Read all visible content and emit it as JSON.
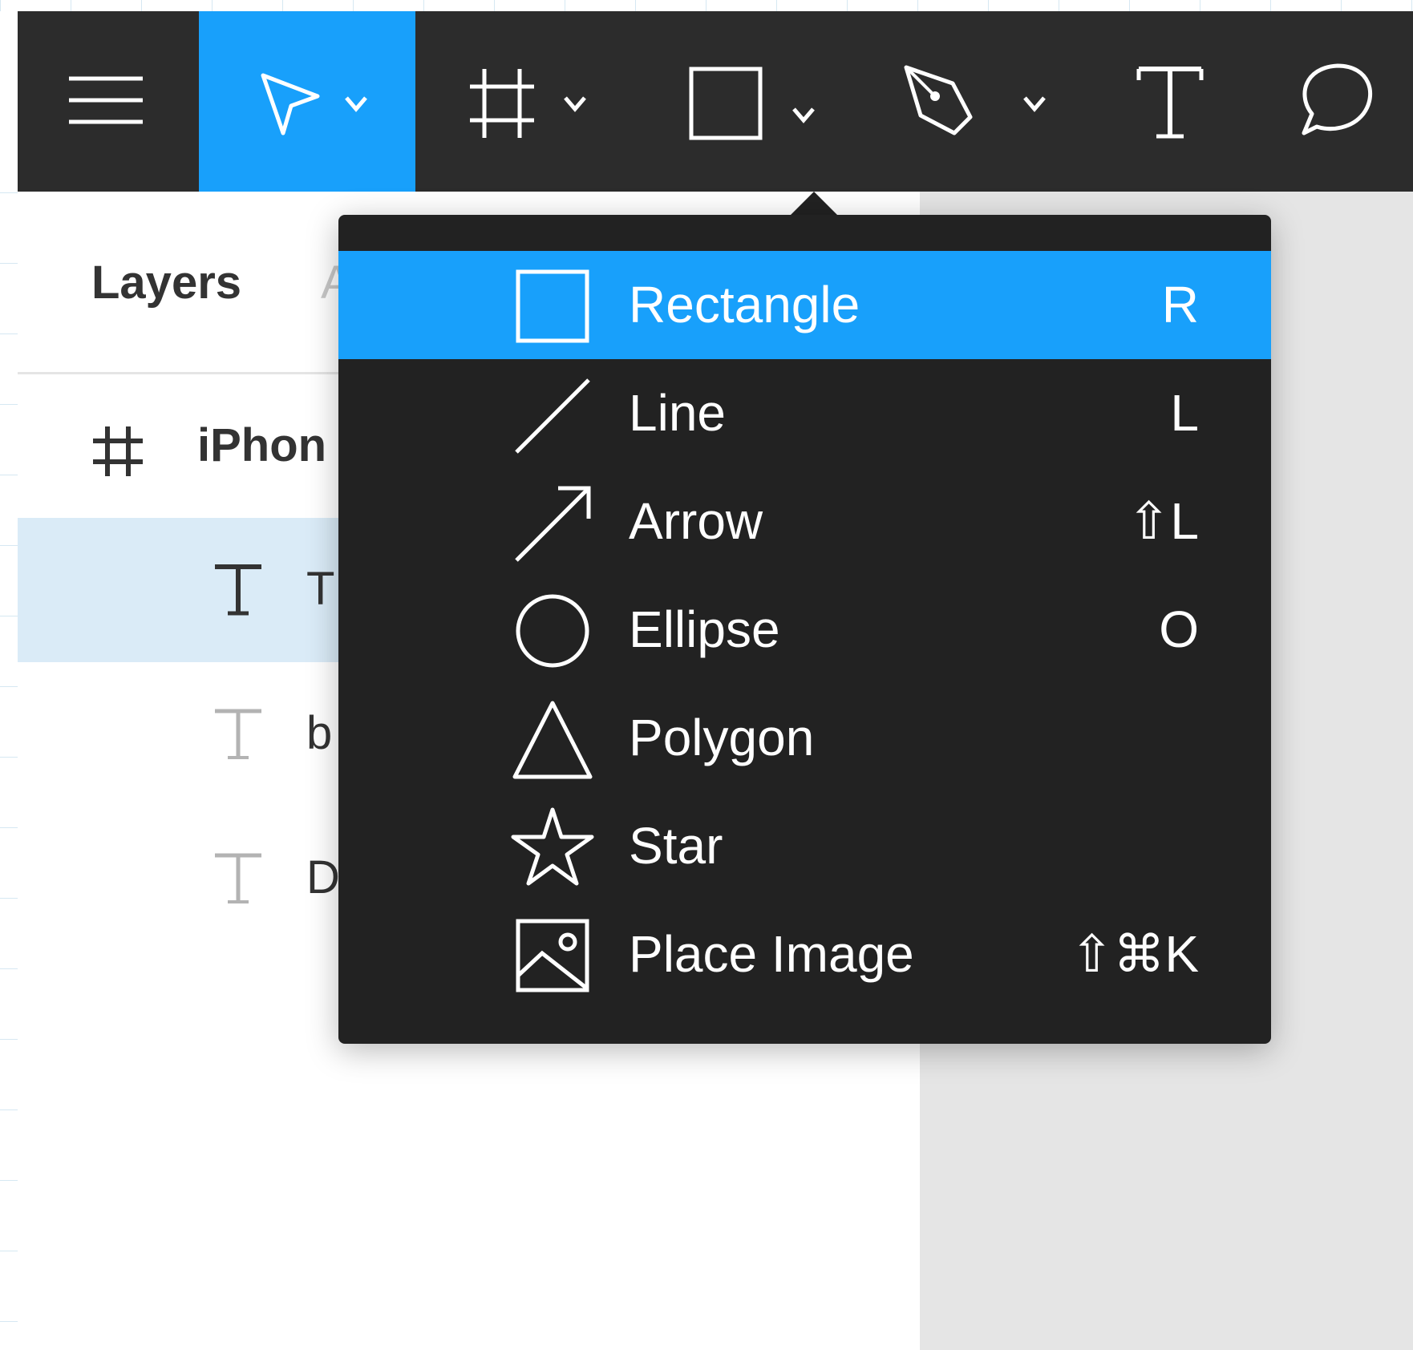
{
  "colors": {
    "toolbar_bg": "#2c2c2c",
    "accent": "#18a0fb",
    "menu_bg": "#222222",
    "panel_bg": "#ffffff",
    "canvas_bg": "#e5e5e5",
    "selected_row_bg": "#daebf7"
  },
  "toolbar": {
    "tools": [
      {
        "icon": "hamburger-menu-icon"
      },
      {
        "icon": "move-cursor-icon",
        "active": true
      },
      {
        "icon": "frame-hash-icon"
      },
      {
        "icon": "rectangle-icon"
      },
      {
        "icon": "pen-nib-icon"
      },
      {
        "icon": "text-icon"
      },
      {
        "icon": "comment-bubble-icon"
      }
    ]
  },
  "layers_panel": {
    "tabs": [
      {
        "label": "Layers"
      },
      {
        "label": "A"
      }
    ],
    "rows": [
      {
        "icon": "frame-hash-icon",
        "label": "iPhon"
      },
      {
        "icon": "text-icon",
        "label": "T",
        "selected": true
      },
      {
        "icon": "text-icon",
        "label": "b"
      },
      {
        "icon": "text-icon",
        "label": "D"
      }
    ]
  },
  "shape_menu": {
    "items": [
      {
        "label": "Rectangle",
        "shortcut": "R",
        "icon": "rectangle-icon",
        "highlighted": true
      },
      {
        "label": "Line",
        "shortcut": "L",
        "icon": "line-icon"
      },
      {
        "label": "Arrow",
        "shortcut": "⇧L",
        "icon": "arrow-icon"
      },
      {
        "label": "Ellipse",
        "shortcut": "O",
        "icon": "ellipse-icon"
      },
      {
        "label": "Polygon",
        "shortcut": "",
        "icon": "polygon-icon"
      },
      {
        "label": "Star",
        "shortcut": "",
        "icon": "star-icon"
      },
      {
        "label": "Place Image",
        "shortcut": "⇧⌘K",
        "icon": "image-icon"
      }
    ]
  }
}
